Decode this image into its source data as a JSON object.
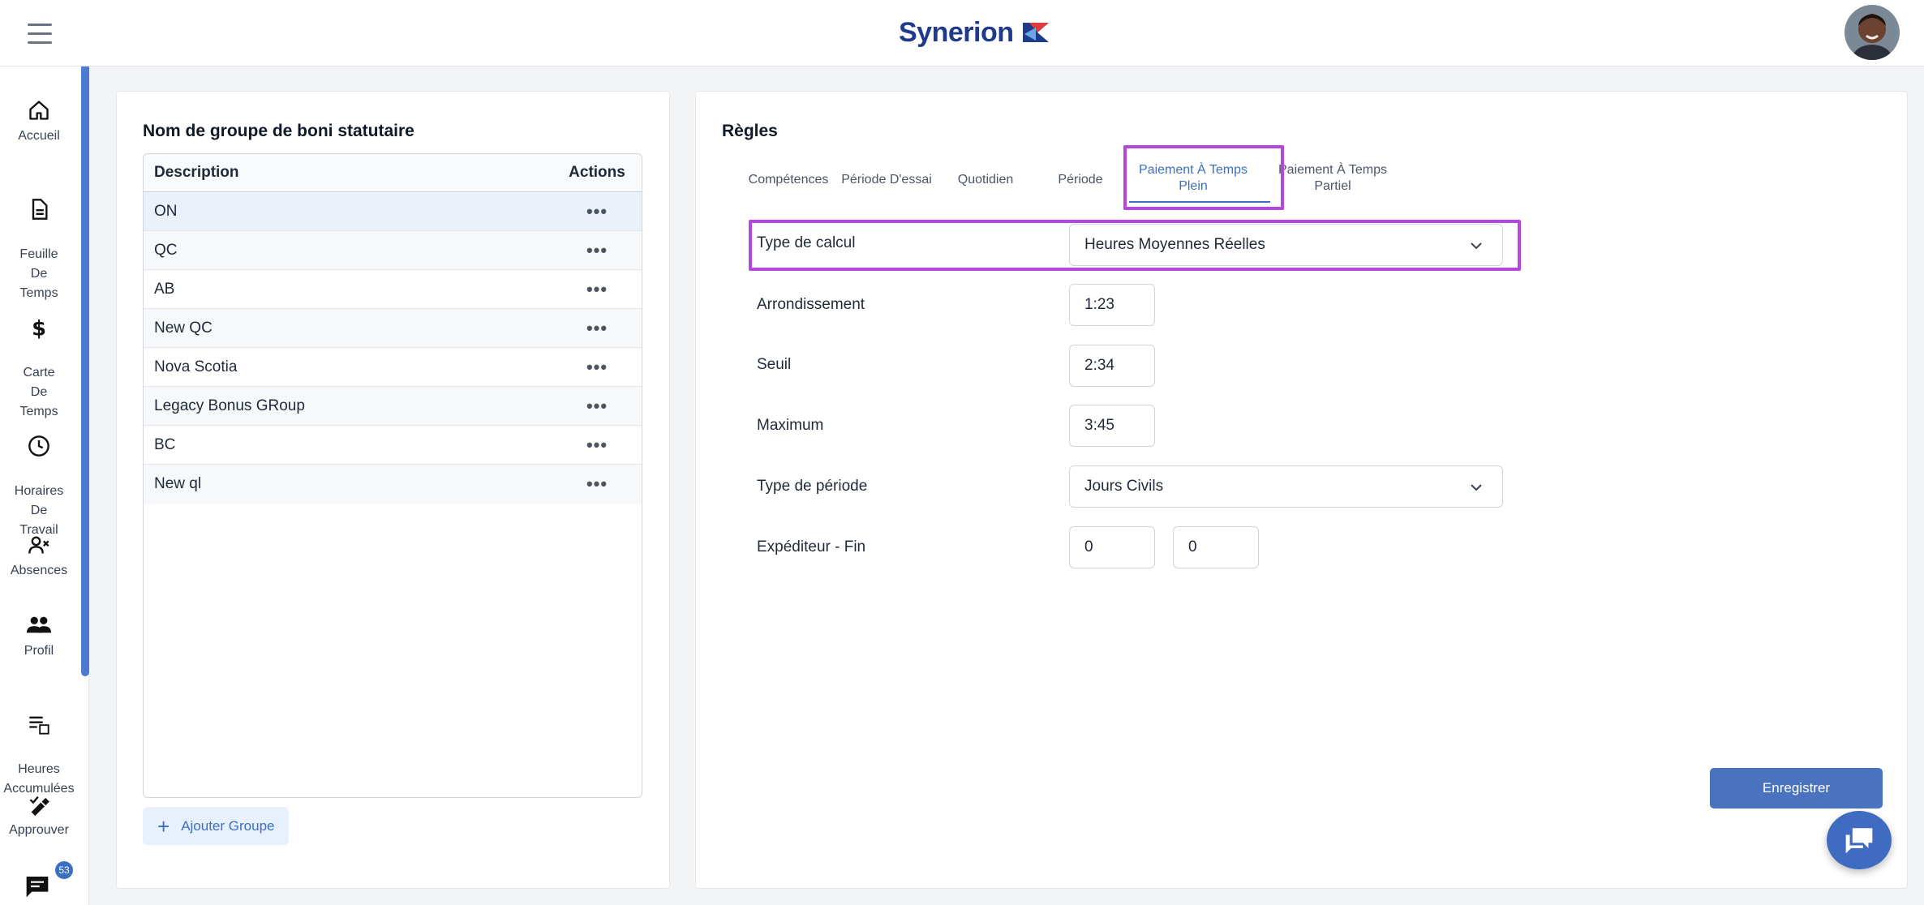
{
  "header": {
    "brand": "Synerion"
  },
  "sidebar": {
    "items": [
      {
        "label": "Accueil",
        "icon": "home-icon"
      },
      {
        "label": "Feuille\nDe\nTemps",
        "icon": "document-icon"
      },
      {
        "label": "Carte\nDe\nTemps",
        "icon": "dollar-icon"
      },
      {
        "label": "Horaires\nDe\nTravail",
        "icon": "clock-icon"
      },
      {
        "label": "Absences",
        "icon": "user-remove-icon"
      },
      {
        "label": "Profil",
        "icon": "people-icon"
      },
      {
        "label": "Heures\nAccumulées",
        "icon": "list-calendar-icon"
      },
      {
        "label": "Approuver",
        "icon": "approve-pen-icon"
      }
    ],
    "chat_badge": "53"
  },
  "left_panel": {
    "title": "Nom de groupe de boni statutaire",
    "table": {
      "headers": {
        "description": "Description",
        "actions": "Actions"
      },
      "rows": [
        "ON",
        "QC",
        "AB",
        "New QC",
        "Nova Scotia",
        "Legacy Bonus GRoup",
        "BC",
        "New ql"
      ],
      "actions_glyph": "•••"
    },
    "add_button": "Ajouter Groupe"
  },
  "right_panel": {
    "title": "Règles",
    "tabs": [
      "Compétences",
      "Période D'essai",
      "Quotidien",
      "Période",
      "Paiement À Temps Plein",
      "Paiement À Temps Partiel"
    ],
    "active_tab": "Paiement À Temps Plein",
    "fields": {
      "calc_type": {
        "label": "Type de calcul",
        "value": "Heures Moyennes Réelles"
      },
      "rounding": {
        "label": "Arrondissement",
        "value": "1:23"
      },
      "threshold": {
        "label": "Seuil",
        "value": "2:34"
      },
      "maximum": {
        "label": "Maximum",
        "value": "3:45"
      },
      "period_type": {
        "label": "Type de période",
        "value": "Jours Civils"
      },
      "sender_end": {
        "label": "Expéditeur - Fin",
        "value_start": "0",
        "value_end": "0"
      }
    },
    "save_button": "Enregistrer"
  },
  "colors": {
    "accent": "#3b6fc4",
    "highlight": "#b347e0",
    "brand_navy": "#1e3a8a",
    "brand_red": "#e03a3e"
  }
}
